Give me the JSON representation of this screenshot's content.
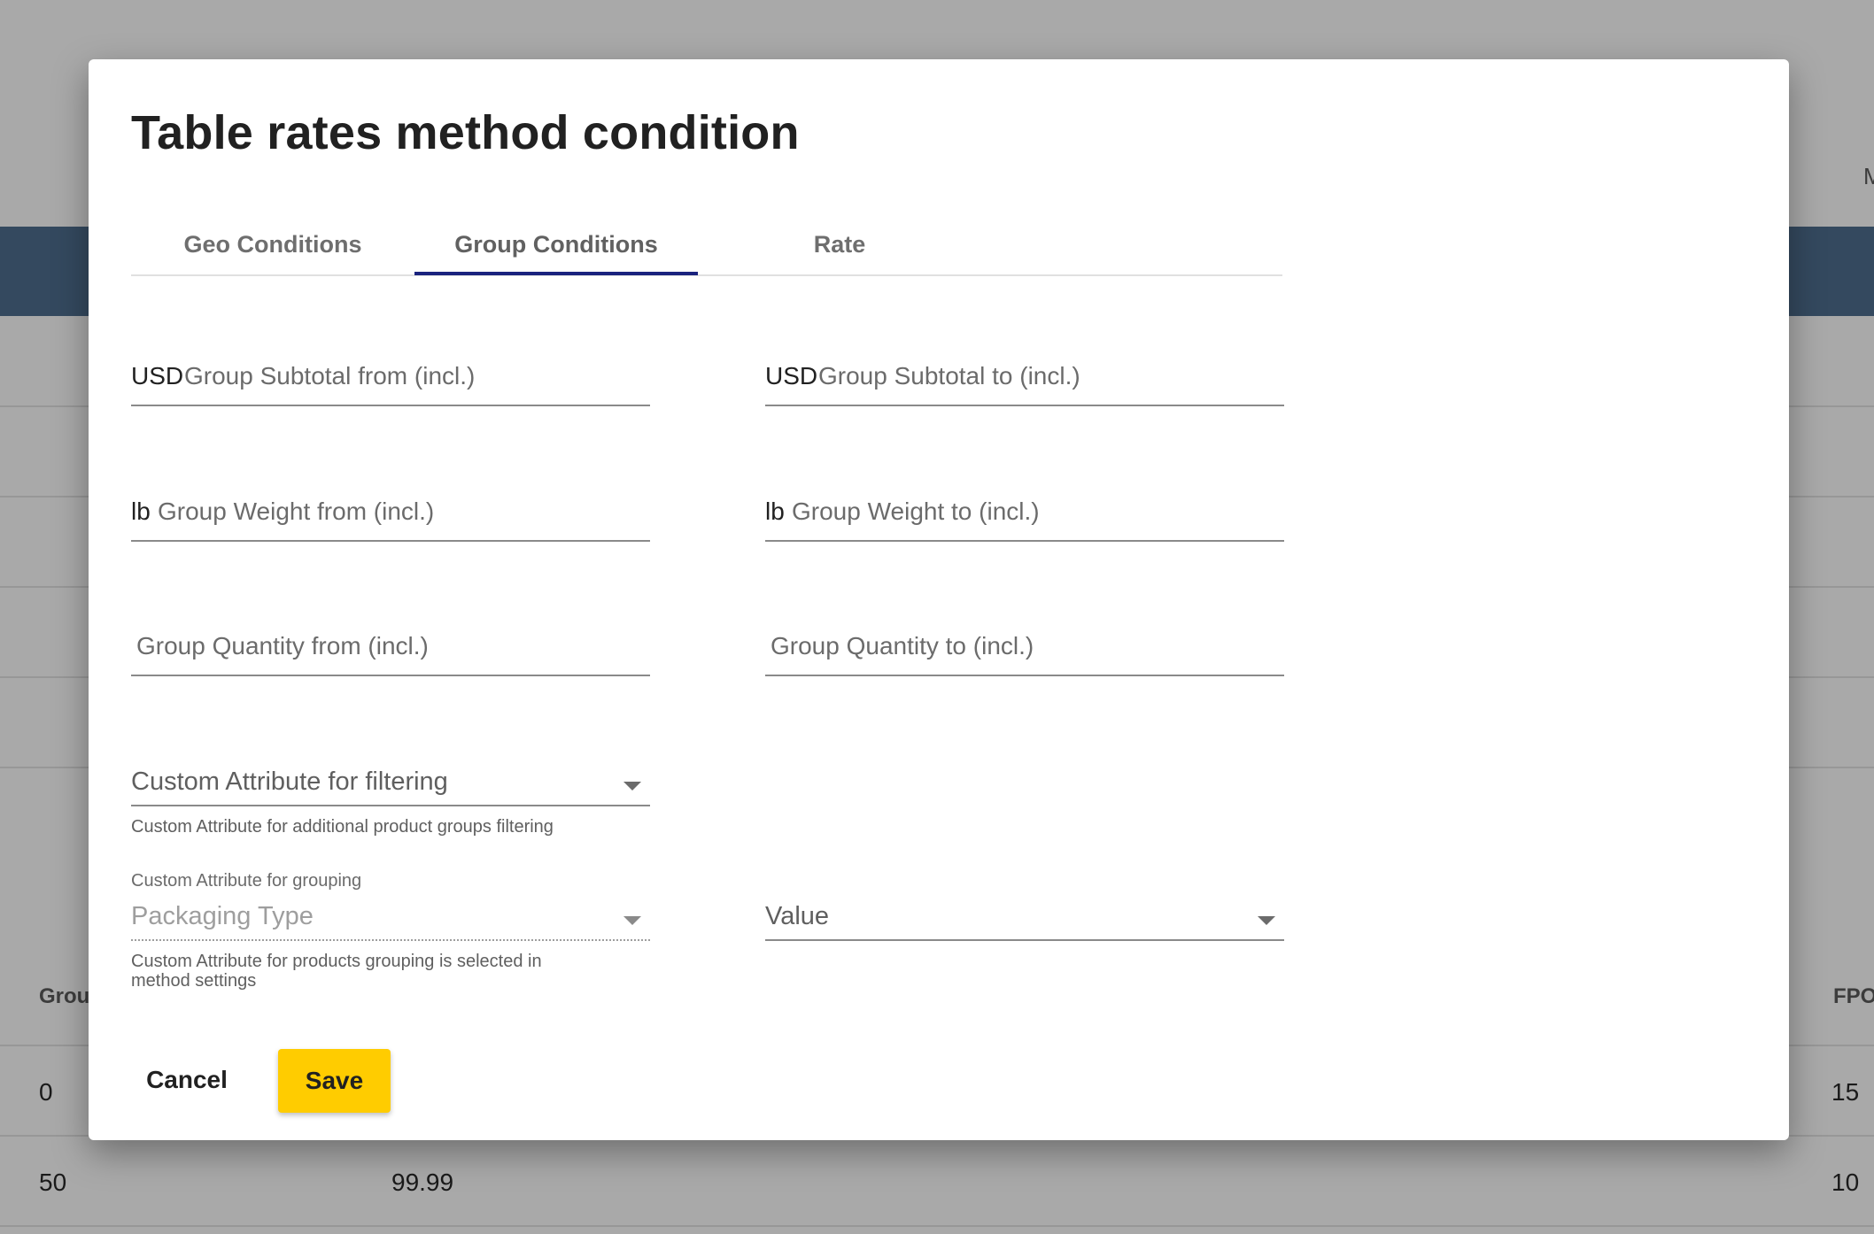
{
  "background": {
    "header_partial": "M",
    "table_headers": {
      "left": "Grou",
      "right": "FPO"
    },
    "rows": [
      {
        "col1": "0",
        "col2": "",
        "col3": "15"
      },
      {
        "col1": "50",
        "col2": "99.99",
        "col3": "10"
      }
    ]
  },
  "dialog": {
    "title": "Table rates method condition",
    "tabs": [
      {
        "label": "Geo Conditions"
      },
      {
        "label": "Group Conditions"
      },
      {
        "label": "Rate"
      }
    ],
    "active_tab": "Group Conditions",
    "fields": {
      "subtotal_from": {
        "prefix": "USD",
        "placeholder": "Group Subtotal from (incl.)",
        "value": ""
      },
      "subtotal_to": {
        "prefix": "USD",
        "placeholder": "Group Subtotal to (incl.)",
        "value": ""
      },
      "weight_from": {
        "prefix": "lb",
        "placeholder": "Group Weight from (incl.)",
        "value": ""
      },
      "weight_to": {
        "prefix": "lb",
        "placeholder": "Group Weight to (incl.)",
        "value": ""
      },
      "quantity_from": {
        "placeholder": "Group Quantity from (incl.)",
        "value": ""
      },
      "quantity_to": {
        "placeholder": "Group Quantity to (incl.)",
        "value": ""
      }
    },
    "custom_filter": {
      "label": "Custom Attribute for filtering",
      "hint": "Custom Attribute for additional product groups filtering"
    },
    "custom_grouping": {
      "floating_label": "Custom Attribute for grouping",
      "value": "Packaging Type",
      "hint_line1": "Custom Attribute for products grouping is selected in",
      "hint_line2": "method settings"
    },
    "value_select": {
      "label": "Value"
    },
    "buttons": {
      "cancel": "Cancel",
      "save": "Save"
    },
    "colors": {
      "accent_button": "#ffcc00",
      "tab_indicator": "#1a237e",
      "band": "#34495f"
    }
  }
}
